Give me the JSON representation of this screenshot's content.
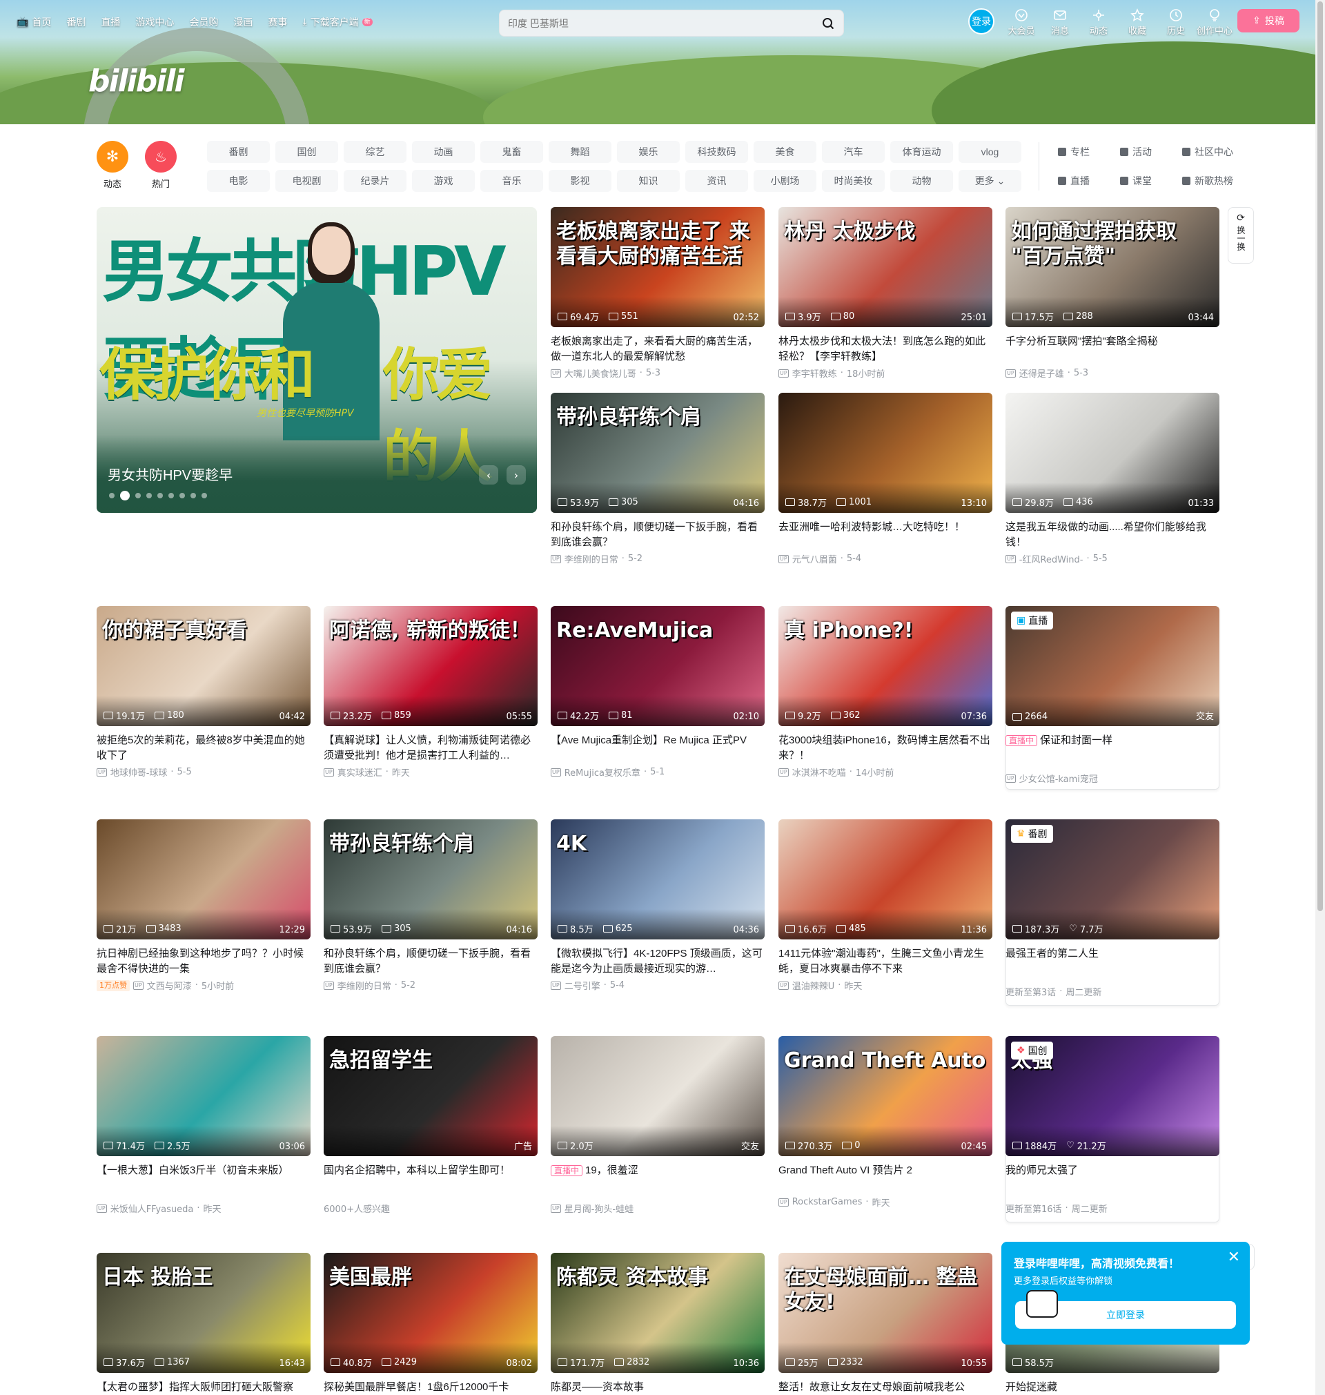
{
  "header": {
    "nav_left": [
      {
        "label": "首页",
        "icon": "tv-icon"
      },
      {
        "label": "番剧"
      },
      {
        "label": "直播"
      },
      {
        "label": "游戏中心"
      },
      {
        "label": "会员购"
      },
      {
        "label": "漫画"
      },
      {
        "label": "赛事"
      },
      {
        "label": "下载客户端",
        "icon": "download-icon",
        "badge": "新"
      }
    ],
    "search_placeholder": "印度 巴基斯坦",
    "login": "登录",
    "nav_right": [
      {
        "label": "大会员",
        "icon": "vip-icon"
      },
      {
        "label": "消息",
        "icon": "message-icon"
      },
      {
        "label": "动态",
        "icon": "dynamic-icon"
      },
      {
        "label": "收藏",
        "icon": "star-icon"
      },
      {
        "label": "历史",
        "icon": "history-icon"
      },
      {
        "label": "创作中心",
        "icon": "bulb-icon"
      }
    ],
    "upload": "投稿",
    "logo": "bilibili"
  },
  "channels": {
    "dynamic": "动态",
    "hot": "热门",
    "row1": [
      "番剧",
      "国创",
      "综艺",
      "动画",
      "鬼畜",
      "舞蹈",
      "娱乐",
      "科技数码",
      "美食",
      "汽车",
      "体育运动",
      "vlog"
    ],
    "row2": [
      "电影",
      "电视剧",
      "纪录片",
      "游戏",
      "音乐",
      "影视",
      "知识",
      "资讯",
      "小剧场",
      "时尚美妆",
      "动物",
      "更多"
    ],
    "side": [
      [
        "专栏",
        "活动",
        "社区中心"
      ],
      [
        "直播",
        "课堂",
        "新歌热榜"
      ]
    ]
  },
  "carousel": {
    "caption": "男女共防HPV要趁早",
    "text1": "男女共防HPV要趁早",
    "text2": "保护你和",
    "text3": "你爱的人",
    "sub": "男性也要尽早预防HPV",
    "accent": "#0e8f78"
  },
  "refresh": "换一换",
  "cards": [
    {
      "title": "老板娘离家出走了，来看看大厨的痛苦生活，做一道东北人的最爱解解忧愁",
      "views": "69.4万",
      "danmaku": "551",
      "dur": "02:52",
      "author": "大嘴儿美食饶儿哥",
      "date": "5-3",
      "overlay": "老板娘离家出走了 来看看大厨的痛苦生活"
    },
    {
      "title": "林丹太极步伐和太极大法！到底怎么跑的如此轻松？【李宇轩教练】",
      "views": "3.9万",
      "danmaku": "80",
      "dur": "25:01",
      "author": "李宇轩教练",
      "date": "18小时前",
      "overlay": "林丹 太极步伐"
    },
    {
      "title": "千字分析互联网\"摆拍\"套路全揭秘",
      "views": "17.5万",
      "danmaku": "288",
      "dur": "03:44",
      "author": "还得是子雄",
      "date": "5-3",
      "overlay": "如何通过摆拍获取 \"百万点赞\""
    },
    {
      "title": "和孙良轩练个肩，顺便切磋一下扳手腕，看看到底谁会赢？",
      "views": "53.9万",
      "danmaku": "305",
      "dur": "04:16",
      "author": "李维刚的日常",
      "date": "5-2",
      "overlay": "带孙良轩练个肩"
    },
    {
      "title": "去亚洲唯一哈利波特影城…大吃特吃！！",
      "views": "38.7万",
      "danmaku": "1001",
      "dur": "13:10",
      "author": "元气八眉菌",
      "date": "5-4",
      "overlay": ""
    },
    {
      "title": "这是我五年级做的动画.....希望你们能够给我钱！",
      "views": "29.8万",
      "danmaku": "436",
      "dur": "01:33",
      "author": "-红风RedWind-",
      "date": "5-5",
      "overlay": ""
    },
    {
      "title": "被拒绝5次的茉莉花，最终被8岁中美混血的她收下了",
      "views": "19.1万",
      "danmaku": "180",
      "dur": "04:42",
      "author": "地球帅哥-球球",
      "date": "5-5",
      "overlay": "你的裙子真好看"
    },
    {
      "title": "【真解说球】让人义愤，利物浦叛徒阿诺德必须遭受批判！他才是损害打工人利益的…",
      "views": "23.2万",
      "danmaku": "859",
      "dur": "05:55",
      "author": "真实球迷汇",
      "date": "昨天",
      "overlay": "阿诺德, 崭新的叛徒！"
    },
    {
      "title": "【Ave Mujica重制企划】Re Mujica 正式PV",
      "views": "42.2万",
      "danmaku": "81",
      "dur": "02:10",
      "author": "ReMujica复权乐章",
      "date": "5-1",
      "overlay": "Re:AveMujica"
    },
    {
      "title": "花3000块组装iPhone16，数码博主居然看不出来？！",
      "views": "9.2万",
      "danmaku": "362",
      "dur": "07:36",
      "author": "冰淇淋不吃喵",
      "date": "14小时前",
      "overlay": "真 iPhone?!"
    },
    {
      "title": "保证和封面一样",
      "views": "2664",
      "dur": "交友",
      "author": "少女公馆-kami宠冠",
      "tag": "直播",
      "live": "直播中"
    },
    {
      "title": "抗日神剧已经抽象到这种地步了吗？？小时候最舍不得快进的一集",
      "views": "21万",
      "danmaku": "3483",
      "dur": "12:29",
      "author": "文西与阿漆",
      "date": "5小时前",
      "badge": "1万点赞",
      "overlay": ""
    },
    {
      "title": "和孙良轩练个肩，顺便切磋一下扳手腕，看看到底谁会赢？",
      "views": "53.9万",
      "danmaku": "305",
      "dur": "04:16",
      "author": "李维刚的日常",
      "date": "5-2",
      "overlay": "带孙良轩练个肩"
    },
    {
      "title": "【微软模拟飞行】4K-120FPS 顶级画质，这可能是迄今为止画质最接近现实的游…",
      "views": "8.5万",
      "danmaku": "625",
      "dur": "04:36",
      "author": "二号引擎",
      "date": "5-4",
      "overlay": "4K"
    },
    {
      "title": "1411元体验\"潮汕毒药\"，生腌三文鱼小青龙生蚝，夏日冰爽暴击停不下来",
      "views": "16.6万",
      "danmaku": "485",
      "dur": "11:36",
      "author": "温油辣辣U",
      "date": "昨天",
      "overlay": ""
    },
    {
      "title": "最强王者的第二人生",
      "views": "187.3万",
      "likes": "7.7万",
      "author": "更新至第3话",
      "date": "周二更新",
      "tag": "番剧"
    },
    {
      "title": "【一根大葱】白米饭3斤半（初音未来版）",
      "views": "71.4万",
      "danmaku": "2.5万",
      "dur": "03:06",
      "author": "米饭仙人FFyasueda",
      "date": "昨天",
      "overlay": ""
    },
    {
      "title": "国内名企招聘中，本科以上留学生即可！",
      "dur": "广告",
      "author": "6000+人感兴趣",
      "overlay": "急招留学生"
    },
    {
      "title": "19，很羞涩",
      "views": "2.0万",
      "dur": "交友",
      "author": "星月阁-狗头-蛙蛙",
      "live": "直播中"
    },
    {
      "title": "Grand Theft Auto VI 预告片 2",
      "views": "270.3万",
      "danmaku": "0",
      "dur": "02:45",
      "author": "RockstarGames",
      "date": "昨天",
      "overlay": "Grand Theft Auto"
    },
    {
      "title": "我的师兄太强了",
      "views": "1884万",
      "likes": "21.2万",
      "author": "更新至第16话",
      "date": "周二更新",
      "tag": "国创",
      "overlay": "太强"
    },
    {
      "title": "【太君の噩梦】指挥大阪师团打砸大阪警察",
      "views": "37.6万",
      "danmaku": "1367",
      "dur": "16:43",
      "overlay": "日本 投胎王"
    },
    {
      "title": "探秘美国最胖早餐店！1盘6斤12000千卡",
      "views": "40.8万",
      "danmaku": "2429",
      "dur": "08:02",
      "overlay": "美国最胖"
    },
    {
      "title": "陈都灵——资本故事",
      "views": "171.7万",
      "danmaku": "2832",
      "dur": "10:36",
      "overlay": "陈都灵 资本故事"
    },
    {
      "title": "整活！故意让女友在丈母娘面前喊我老公",
      "views": "25万",
      "danmaku": "2332",
      "dur": "10:55",
      "overlay": "在丈母娘面前… 整蛊女友!"
    },
    {
      "title": "开始捉迷藏",
      "views": "58.5万"
    }
  ],
  "popup": {
    "title": "登录哔哩哔哩，高清视频免费看！",
    "sub": "更多登录后权益等你解锁",
    "button": "立即登录"
  }
}
